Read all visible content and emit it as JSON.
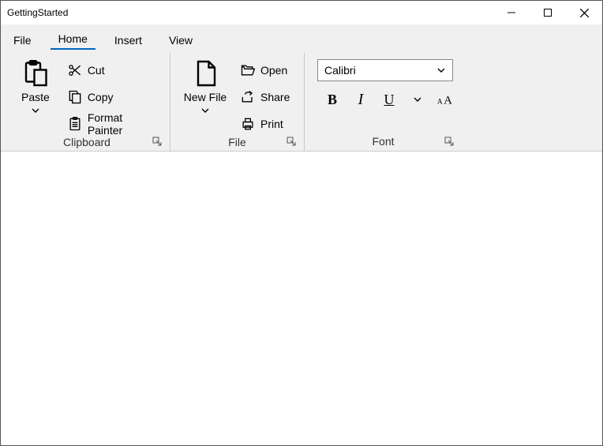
{
  "window": {
    "title": "GettingStarted"
  },
  "tabs": [
    "File",
    "Home",
    "Insert",
    "View"
  ],
  "active_tab": "Home",
  "groups": {
    "clipboard": {
      "label": "Clipboard",
      "paste": "Paste",
      "cut": "Cut",
      "copy": "Copy",
      "format_painter": "Format Painter"
    },
    "file": {
      "label": "File",
      "new_file": "New File",
      "open": "Open",
      "share": "Share",
      "print": "Print"
    },
    "font": {
      "label": "Font",
      "family": "Calibri"
    }
  }
}
